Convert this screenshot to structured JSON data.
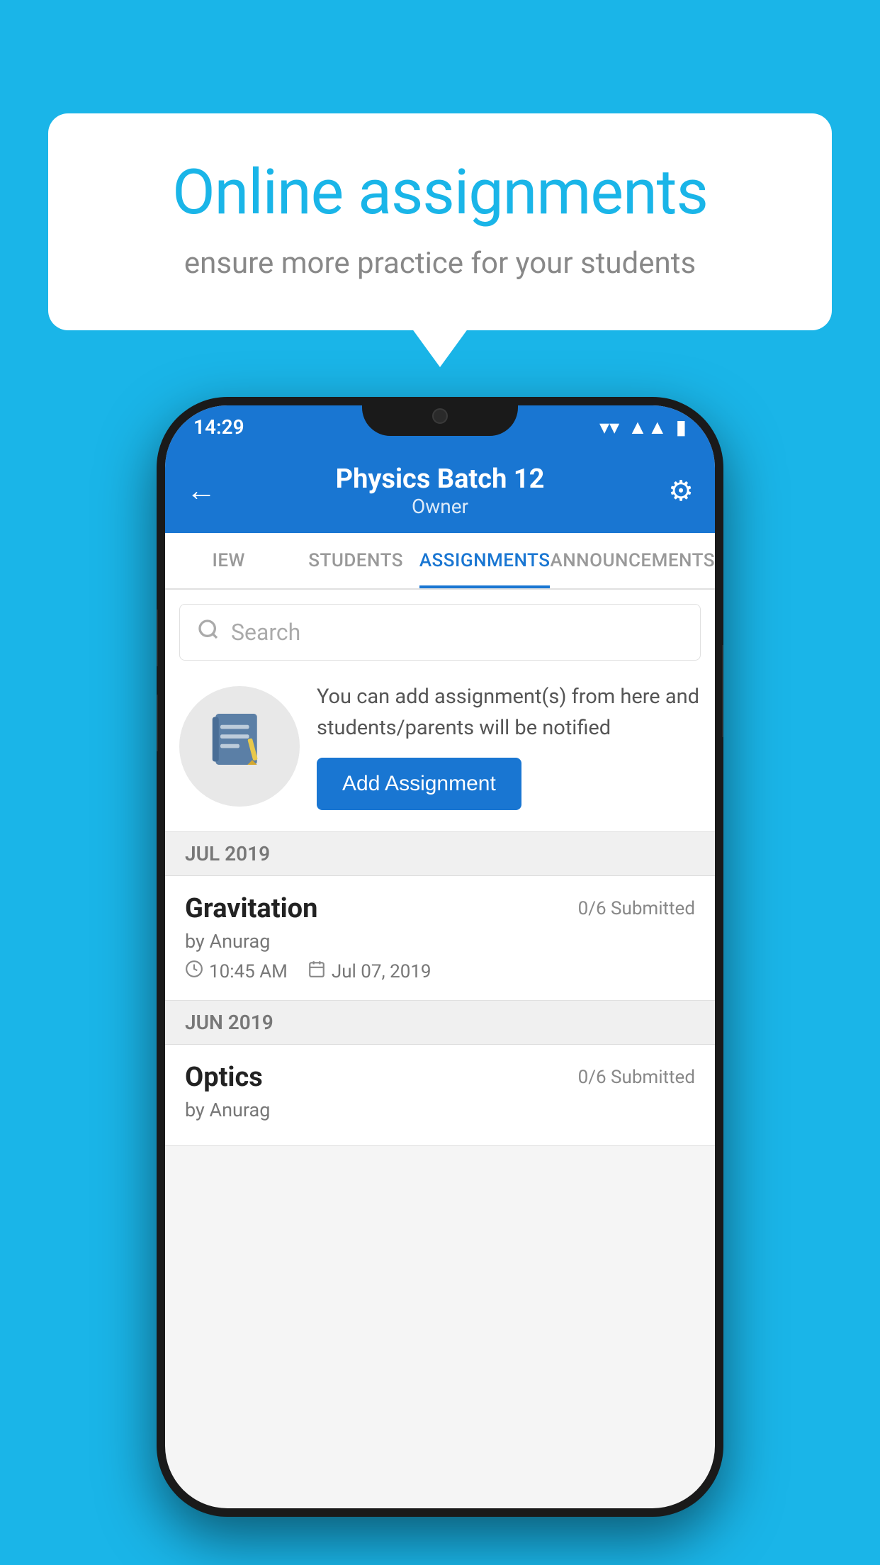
{
  "background_color": "#1ab5e8",
  "speech_bubble": {
    "title": "Online assignments",
    "subtitle": "ensure more practice for your students"
  },
  "phone": {
    "status_bar": {
      "time": "14:29",
      "icons": [
        "wifi",
        "signal",
        "battery"
      ]
    },
    "header": {
      "title": "Physics Batch 12",
      "subtitle": "Owner",
      "back_label": "←",
      "settings_label": "⚙"
    },
    "tabs": [
      {
        "label": "IEW",
        "active": false
      },
      {
        "label": "STUDENTS",
        "active": false
      },
      {
        "label": "ASSIGNMENTS",
        "active": true
      },
      {
        "label": "ANNOUNCEMENTS",
        "active": false
      }
    ],
    "search": {
      "placeholder": "Search"
    },
    "promo": {
      "text": "You can add assignment(s) from here and students/parents will be notified",
      "button_label": "Add Assignment"
    },
    "sections": [
      {
        "label": "JUL 2019",
        "assignments": [
          {
            "name": "Gravitation",
            "submitted": "0/6 Submitted",
            "author": "by Anurag",
            "time": "10:45 AM",
            "date": "Jul 07, 2019"
          }
        ]
      },
      {
        "label": "JUN 2019",
        "assignments": [
          {
            "name": "Optics",
            "submitted": "0/6 Submitted",
            "author": "by Anurag",
            "time": "",
            "date": ""
          }
        ]
      }
    ]
  }
}
